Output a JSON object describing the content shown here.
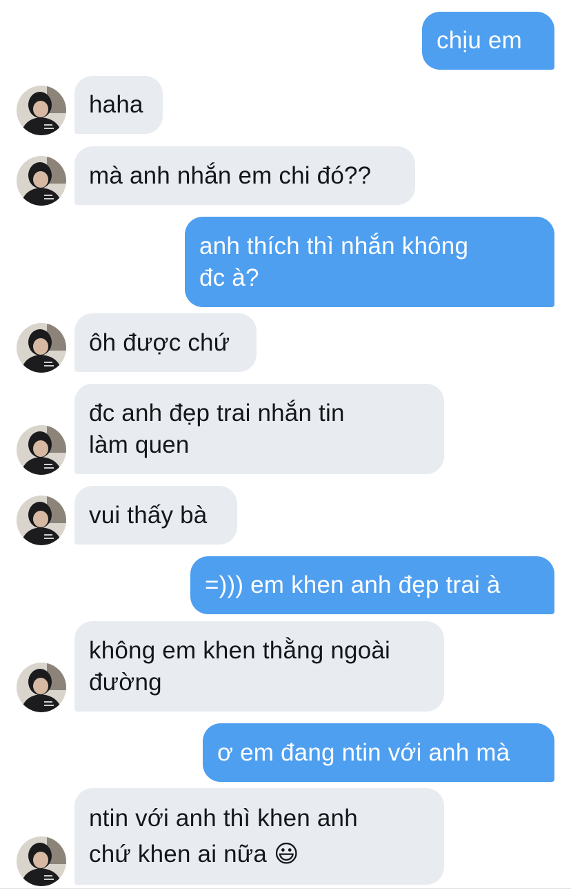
{
  "messages": [
    {
      "dir": "out",
      "text": "chịu em"
    },
    {
      "dir": "in",
      "text": "haha"
    },
    {
      "dir": "in",
      "text": "mà anh nhắn em chi đó??"
    },
    {
      "dir": "out",
      "text": "anh thích thì nhắn không\nđc à?"
    },
    {
      "dir": "in",
      "text": "ôh được chứ"
    },
    {
      "dir": "in",
      "text": "đc anh đẹp trai nhắn tin\nlàm quen"
    },
    {
      "dir": "in",
      "text": "vui thấy bà"
    },
    {
      "dir": "out",
      "text": "=))) em khen anh đẹp trai à"
    },
    {
      "dir": "in",
      "text": "không em khen thằng ngoài\nđường"
    },
    {
      "dir": "out",
      "text": "ơ em đang ntin với anh mà"
    },
    {
      "dir": "in",
      "text": "ntin với anh thì khen anh\nchứ khen ai nữa 😃"
    }
  ],
  "colors": {
    "outgoing_bubble": "#4e9ff0",
    "incoming_bubble": "#e8ecf0",
    "outgoing_text": "#ffffff",
    "incoming_text": "#14171a"
  },
  "icons": {
    "avatar": "contact-avatar-photo"
  }
}
